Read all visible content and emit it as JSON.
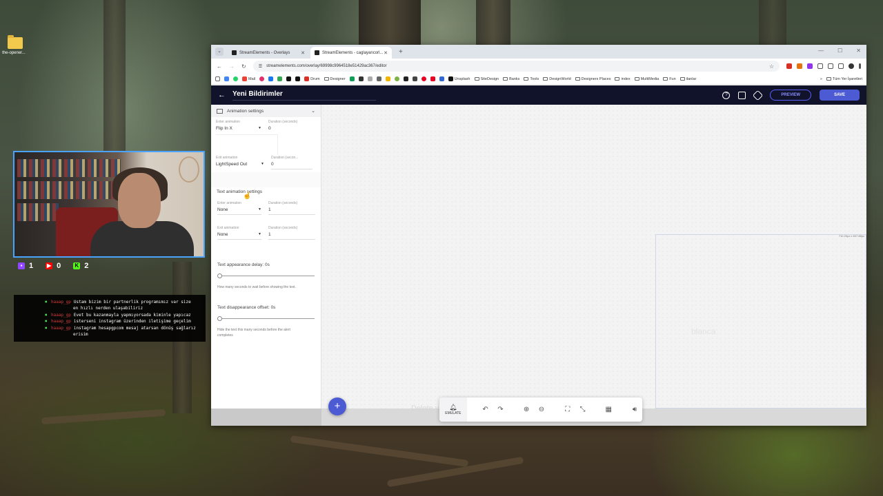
{
  "desktop": {
    "icon_label": "the-opener..."
  },
  "stream_stats": {
    "twitch": "1",
    "youtube": "0",
    "kick": "2"
  },
  "chat": {
    "lines": [
      {
        "user": "haaap_gp",
        "text": "Ustam bizim bir partnerlik programımız var size"
      },
      {
        "user": "",
        "text": "en hızlı nerden ulaşabiliriz"
      },
      {
        "user": "haaap_gp",
        "text": "Evet bu kazanmayla yapmıyorsada kiminle yapıcaz"
      },
      {
        "user": "haaap_gp",
        "text": "isterseni instagram üzerinden iletişime geçelim"
      },
      {
        "user": "haaap_gp",
        "text": "instagram hesapgpcom mesaj atarsan dönüş sağlarız"
      },
      {
        "user": "",
        "text": "erisim"
      }
    ]
  },
  "browser": {
    "tabs": [
      {
        "label": "StreamElements - Overlays",
        "active": false
      },
      {
        "label": "StreamElements - caglayancorl...",
        "active": true
      }
    ],
    "url": "streamelements.com/overlay/69998c9964518e51429ac367/editor",
    "bookmarks": [
      "Mail",
      "Drum",
      "Designer",
      "Unsplash",
      "SiteDesign",
      "Banks",
      "Tools",
      "DesignWorld",
      "Designers Places",
      "index",
      "MultiMedia",
      "Fun",
      "ilanlar"
    ],
    "all_bookmarks": "Tüm Yer İşaretleri"
  },
  "app": {
    "title": "Yeni Bildirimler",
    "preview_label": "PREVIEW",
    "save_label": "SAVE"
  },
  "panel": {
    "animation_section": "Animation settings",
    "enter_animation_label": "Enter animation",
    "enter_animation_value": "Flip In X",
    "enter_duration_label": "Duration (seconds)",
    "enter_duration_value": "0",
    "exit_animation_label": "Exit animation",
    "exit_animation_value": "LightSpeed Out",
    "exit_duration_label": "Duration (secon...",
    "exit_duration_value": "0",
    "text_animation_section": "Text animation settings",
    "text_enter_label": "Enter animation",
    "text_enter_value": "None",
    "text_enter_duration_label": "Duration (seconds)",
    "text_enter_duration_value": "1",
    "text_exit_label": "Exit animation",
    "text_exit_value": "None",
    "text_exit_duration_label": "Duration (seconds)",
    "text_exit_duration_value": "1",
    "appearance_delay_title": "Text appearance delay: 0s",
    "appearance_delay_value": 0,
    "appearance_delay_help": "How many seconds to wait before showing the text.",
    "disappearance_offset_title": "Text disappearance offset: 0s",
    "disappearance_offset_value": 0,
    "disappearance_offset_help": "Hide the text this many seconds before the alert completes"
  },
  "canvas": {
    "frame_size_label": "710.20px x 607.88px",
    "ghost_text": "blanca",
    "ghost_text_2": "Delete v",
    "emulate_label": "EMULATE"
  },
  "colors": {
    "header_bg": "#11132a",
    "accent": "#4c5bd4",
    "webcam_border": "#4aa3ff"
  }
}
